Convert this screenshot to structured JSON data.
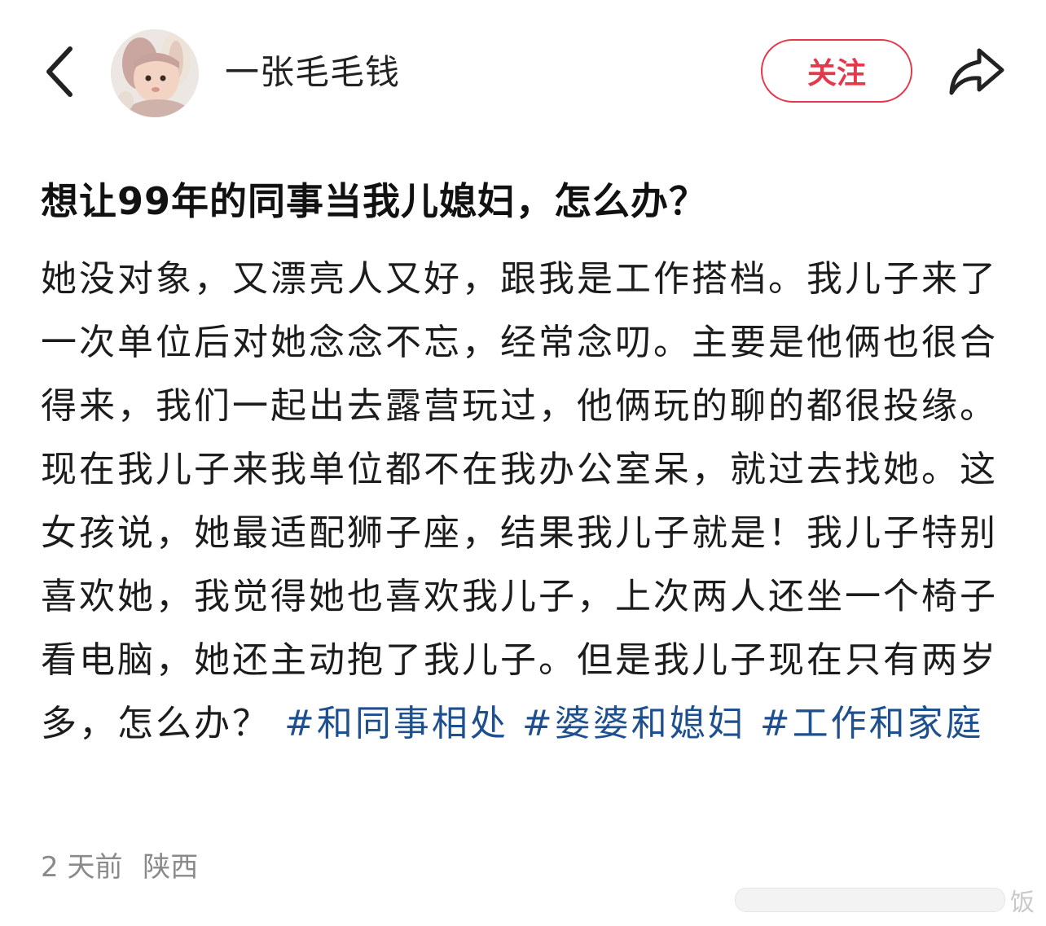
{
  "header": {
    "back_icon": "chevron-left-icon",
    "avatar_alt": "avatar",
    "username": "一张毛毛钱",
    "follow_label": "关注",
    "share_icon": "share-arrow-icon",
    "follow_color": "#e5384a"
  },
  "post": {
    "title": "想让99年的同事当我儿媳妇，怎么办？",
    "body": "她没对象，又漂亮人又好，跟我是工作搭档。我儿子来了一次单位后对她念念不忘，经常念叨。主要是他俩也很合得来，我们一起出去露营玩过，他俩玩的聊的都很投缘。现在我儿子来我单位都不在我办公室呆，就过去找她。这女孩说，她最适配狮子座，结果我儿子就是！我儿子特别喜欢她，我觉得她也喜欢我儿子，上次两人还坐一个椅子看电脑，她还主动抱了我儿子。但是我儿子现在只有两岁多，怎么办？",
    "hashtags": [
      "#和同事相处",
      "#婆婆和媳妇",
      "#工作和家庭"
    ],
    "hashtag_color": "#1e4f8e"
  },
  "meta": {
    "time": "2 天前",
    "location": "陕西"
  },
  "watermark": {
    "text": "饭"
  }
}
